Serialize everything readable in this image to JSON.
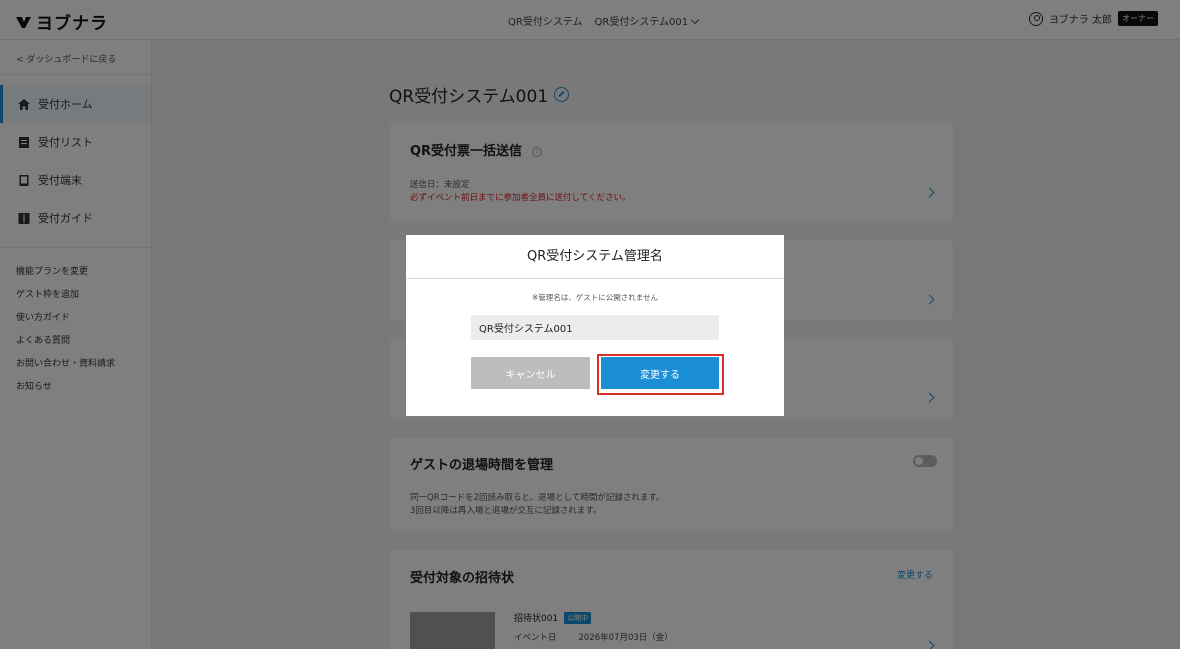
{
  "header": {
    "logo_text": "ヨブナラ",
    "nav": [
      "QR受付システム",
      "QR受付システム001"
    ],
    "user_name": "ヨブナラ 太郎",
    "role_badge": "オーナー"
  },
  "sidebar": {
    "back_link": "< ダッシュボードに戻る",
    "items": [
      {
        "label": "受付ホーム",
        "icon": "home-icon",
        "active": true
      },
      {
        "label": "受付リスト",
        "icon": "list-icon",
        "active": false
      },
      {
        "label": "受付端末",
        "icon": "device-icon",
        "active": false
      },
      {
        "label": "受付ガイド",
        "icon": "guide-icon",
        "active": false
      }
    ],
    "links": [
      "機能プランを変更",
      "ゲスト枠を追加",
      "使い方ガイド",
      "よくある質問",
      "お問い合わせ・資料請求",
      "お知らせ"
    ]
  },
  "main": {
    "title": "QR受付システム001",
    "bulk_send": {
      "title": "QR受付票一括送信",
      "help": "?",
      "send_date": "送信日：未設定",
      "warning": "必ずイベント前日までに参加者全員に送付してください。"
    },
    "exit_time": {
      "title": "ゲストの退場時間を管理",
      "desc_line1": "同一QRコードを2回読み取ると、退場として時間が記録されます。",
      "desc_line2": "3回目以降は再入場と退場が交互に記録されます。"
    },
    "invitation": {
      "title": "受付対象の招待状",
      "change_link": "変更する",
      "name": "招待状001",
      "status": "公開中",
      "event_label": "イベント日",
      "event_date": "2026年07月03日（金）"
    }
  },
  "modal": {
    "title": "QR受付システム管理名",
    "note": "※管理名は、ゲストに公開されません",
    "input_value": "QR受付システム001",
    "cancel_label": "キャンセル",
    "confirm_label": "変更する"
  },
  "colors": {
    "accent": "#1a8fd6",
    "warning": "#dd2222",
    "highlight": "#d9302c"
  }
}
